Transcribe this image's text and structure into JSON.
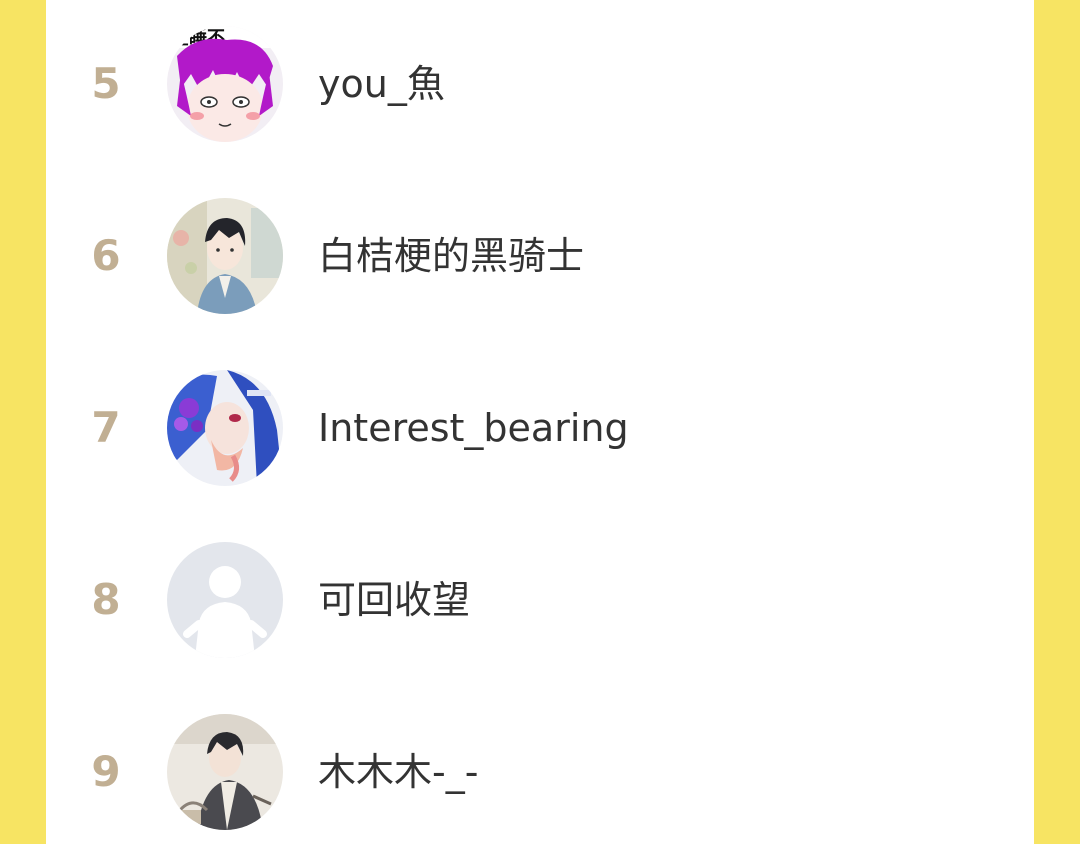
{
  "leaderboard": {
    "rows": [
      {
        "rank": "5",
        "name": "you_魚",
        "avatar": "anime-avatar-purple-hair"
      },
      {
        "rank": "6",
        "name": "白桔梗的黑骑士",
        "avatar": "anime-avatar-dark-hair-suit"
      },
      {
        "rank": "7",
        "name": "Interest_bearing",
        "avatar": "anime-avatar-blue-hair-flowers"
      },
      {
        "rank": "8",
        "name": "可回收望",
        "avatar": "default-avatar-placeholder"
      },
      {
        "rank": "9",
        "name": "木木木-_-",
        "avatar": "anime-avatar-dark-hair-sketch"
      }
    ]
  },
  "colors": {
    "background": "#f7e463",
    "panel": "#ffffff",
    "rank_text": "#c1af93",
    "name_text": "#333333"
  }
}
